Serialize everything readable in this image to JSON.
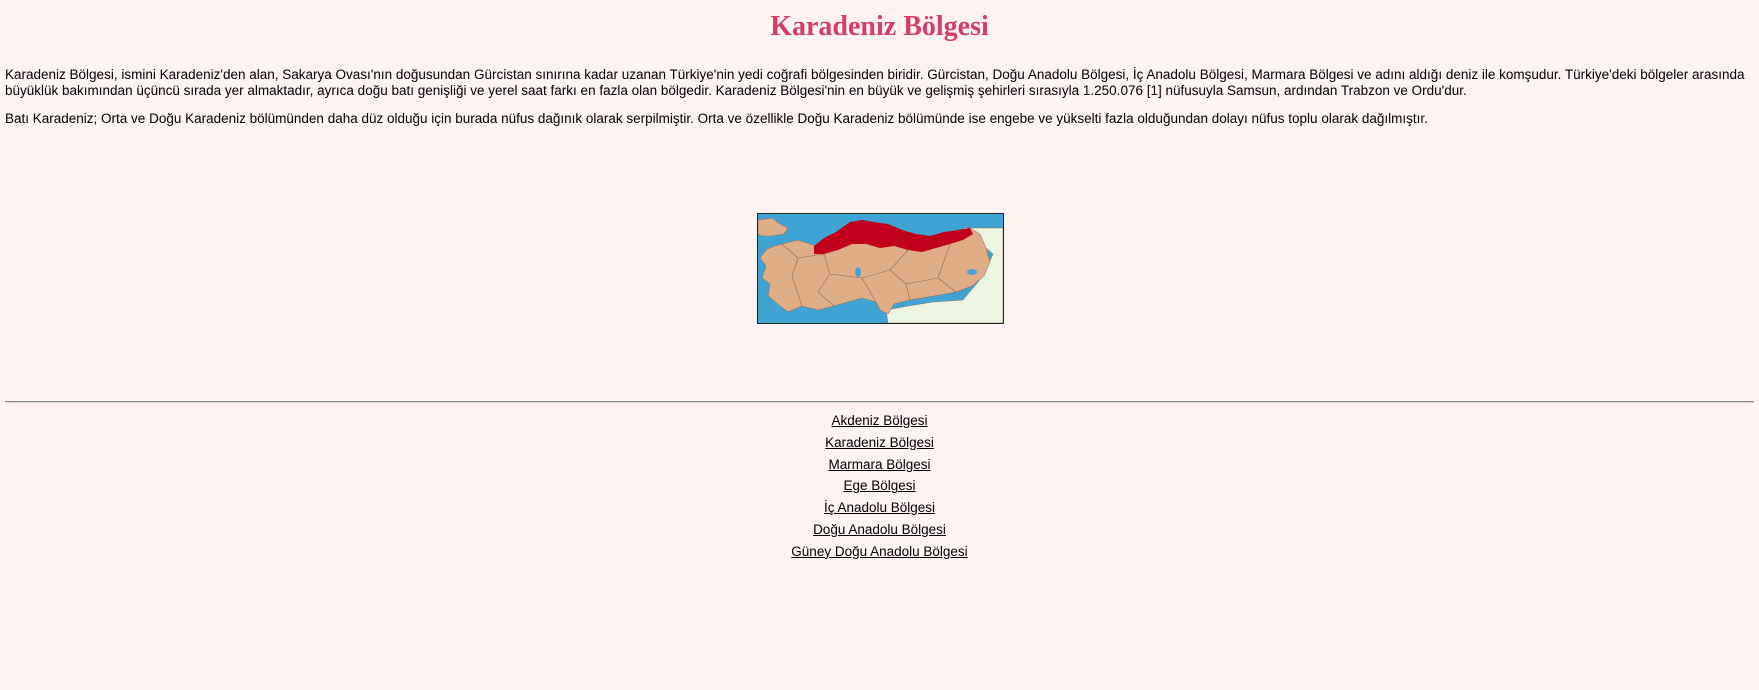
{
  "page": {
    "title": "Karadeniz Bölgesi",
    "paragraphs": [
      "Karadeniz Bölgesi, ismini Karadeniz'den alan, Sakarya Ovası'nın doğusundan Gürcistan sınırına kadar uzanan Türkiye'nin yedi coğrafi bölgesinden biridir. Gürcistan, Doğu Anadolu Bölgesi, İç Anadolu Bölgesi, Marmara Bölgesi ve adını aldığı deniz ile komşudur. Türkiye'deki bölgeler arasında büyüklük bakımından üçüncü sırada yer almaktadır, ayrıca doğu batı genişliği ve yerel saat farkı en fazla olan bölgedir. Karadeniz Bölgesi'nin en büyük ve gelişmiş şehirleri sırasıyla 1.250.076 [1] nüfusuyla Samsun, ardından Trabzon ve Ordu'dur.",
      "Batı Karadeniz; Orta ve Doğu Karadeniz bölümünden daha düz olduğu için burada nüfus dağınık olarak serpilmiştir. Orta ve özellikle Doğu Karadeniz bölümünde ise engebe ve yükselti fazla olduğundan dolayı nüfus toplu olarak dağılmıştır."
    ]
  },
  "map": {
    "sea_color": "#3fa4d3",
    "land_color": "#e0ae86",
    "neighbor_color": "#eef4e2",
    "highlight_color": "#c0001a",
    "border_color": "#8a6a55"
  },
  "nav": {
    "links": [
      "Akdeniz Bölgesi",
      "Karadeniz Bölgesi",
      "Marmara Bölgesi",
      "Ege Bölgesi",
      "İç Anadolu Bölgesi",
      "Doğu Anadolu Bölgesi",
      "Güney Doğu Anadolu Bölgesi"
    ]
  }
}
